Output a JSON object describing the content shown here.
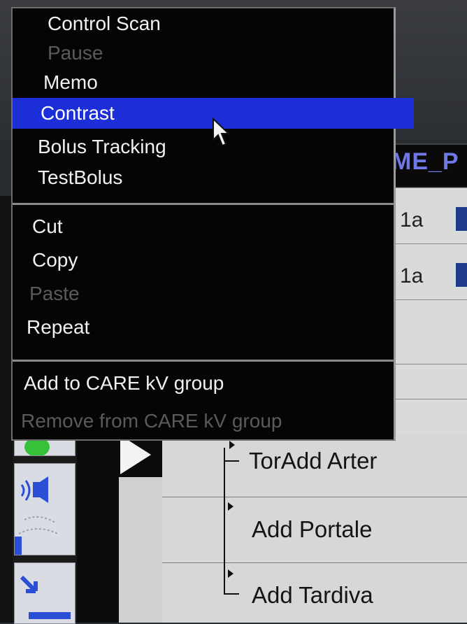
{
  "background": {
    "header_fragment": "ME_P",
    "cell_fragments": [
      "1a",
      "1a"
    ],
    "list_items": [
      "TorAdd Arter",
      "Add Portale",
      "Add Tardiva"
    ]
  },
  "context_menu": {
    "group1": [
      {
        "label": "Control Scan",
        "state": "enabled"
      },
      {
        "label": "Pause",
        "state": "disabled"
      },
      {
        "label": "Memo",
        "state": "enabled"
      },
      {
        "label": "Contrast",
        "state": "selected"
      },
      {
        "label": "Bolus Tracking",
        "state": "enabled"
      },
      {
        "label": "TestBolus",
        "state": "enabled"
      }
    ],
    "group2": [
      {
        "label": "Cut",
        "state": "enabled"
      },
      {
        "label": "Copy",
        "state": "enabled"
      },
      {
        "label": "Paste",
        "state": "disabled"
      },
      {
        "label": "Repeat",
        "state": "enabled"
      }
    ],
    "group3": [
      {
        "label": "Add to CARE kV group",
        "state": "enabled"
      },
      {
        "label": "Remove from CARE kV group",
        "state": "disabled"
      }
    ]
  },
  "colors": {
    "menu_background": "#050505",
    "selection_highlight": "#1c2ed8",
    "disabled_text": "#5a5a5a",
    "header_text": "#6f78e6"
  },
  "icons": [
    "mouse-cursor-icon",
    "play-arrow-icon",
    "sound-wave-icon",
    "status-led-icon",
    "diagonal-arrow-icon"
  ]
}
